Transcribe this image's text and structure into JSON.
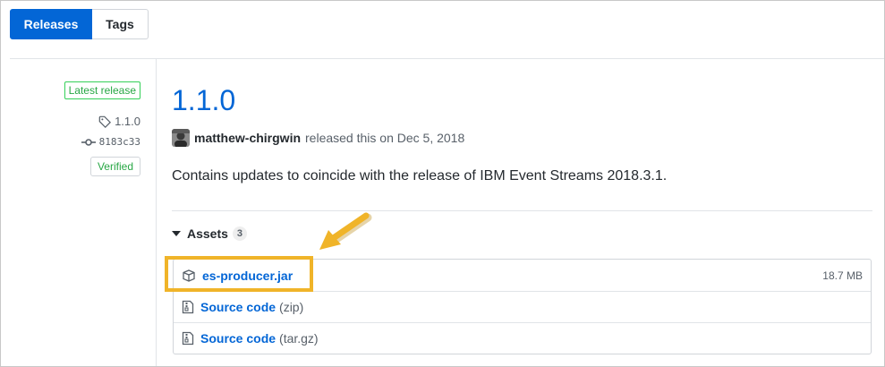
{
  "tabs": {
    "releases": "Releases",
    "tags": "Tags"
  },
  "meta": {
    "latest_badge": "Latest release",
    "tag": "1.1.0",
    "commit": "8183c33",
    "verified": "Verified"
  },
  "release": {
    "title": "1.1.0",
    "author": "matthew-chirgwin",
    "released_text": "released this on Dec 5, 2018",
    "description": "Contains updates to coincide with the release of IBM Event Streams 2018.3.1."
  },
  "assets": {
    "label": "Assets",
    "count": "3",
    "items": [
      {
        "name": "es-producer.jar",
        "suffix": "",
        "size": "18.7 MB",
        "icon": "package-icon"
      },
      {
        "name": "Source code",
        "suffix": "(zip)",
        "size": "",
        "icon": "file-zip-icon"
      },
      {
        "name": "Source code",
        "suffix": "(tar.gz)",
        "size": "",
        "icon": "file-zip-icon"
      }
    ]
  },
  "colors": {
    "accent": "#0366d6",
    "verified": "#28a745",
    "highlight": "#f0b429"
  }
}
